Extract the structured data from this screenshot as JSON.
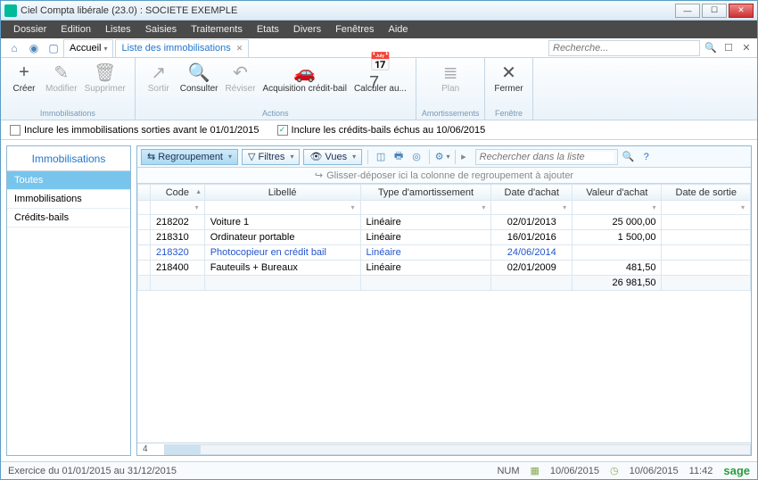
{
  "window": {
    "title": "Ciel Compta libérale (23.0) : SOCIETE EXEMPLE"
  },
  "menu": [
    "Dossier",
    "Edition",
    "Listes",
    "Saisies",
    "Traitements",
    "Etats",
    "Divers",
    "Fenêtres",
    "Aide"
  ],
  "tabs": {
    "home": "Accueil",
    "active": "Liste des immobilisations"
  },
  "nav_search": {
    "placeholder": "Recherche..."
  },
  "ribbon": {
    "groups": [
      {
        "label": "Immobilisations",
        "buttons": [
          {
            "icon": "+",
            "label": "Créer",
            "enabled": true
          },
          {
            "icon": "✎",
            "label": "Modifier",
            "enabled": false
          },
          {
            "icon": "🗑",
            "label": "Supprimer",
            "enabled": false
          }
        ]
      },
      {
        "label": "Actions",
        "buttons": [
          {
            "icon": "↗",
            "label": "Sortir",
            "enabled": false
          },
          {
            "icon": "🔍",
            "label": "Consulter",
            "enabled": true
          },
          {
            "icon": "↶",
            "label": "Réviser",
            "enabled": false
          },
          {
            "icon": "🚗",
            "label": "Acquisition\ncrédit-bail",
            "enabled": true
          },
          {
            "icon": "📅7",
            "label": "Calculer au...",
            "enabled": true
          }
        ]
      },
      {
        "label": "Amortissements",
        "buttons": [
          {
            "icon": "≣",
            "label": "Plan",
            "enabled": false
          }
        ]
      },
      {
        "label": "Fenêtre",
        "buttons": [
          {
            "icon": "✕",
            "label": "Fermer",
            "enabled": true
          }
        ]
      }
    ]
  },
  "filters": {
    "opt1": "Inclure les immobilisations sorties avant le 01/01/2015",
    "opt1_checked": false,
    "opt2": "Inclure les crédits-bails échus au 10/06/2015",
    "opt2_checked": true
  },
  "sidebar": {
    "title": "Immobilisations",
    "items": [
      "Toutes",
      "Immobilisations",
      "Crédits-bails"
    ],
    "selected": 0
  },
  "gridbar": {
    "regroupement": "Regroupement",
    "filtres": "Filtres",
    "vues": "Vues",
    "search_placeholder": "Rechercher dans la liste"
  },
  "grid": {
    "group_hint": "Glisser-déposer ici la colonne de regroupement à ajouter",
    "columns": [
      "Code",
      "Libellé",
      "Type d'amortissement",
      "Date d'achat",
      "Valeur d'achat",
      "Date de sortie"
    ],
    "rows": [
      {
        "code": "218202",
        "libelle": "Voiture 1",
        "type": "Linéaire",
        "date_achat": "02/01/2013",
        "valeur": "25 000,00",
        "sortie": "",
        "link": false
      },
      {
        "code": "218310",
        "libelle": "Ordinateur portable",
        "type": "Linéaire",
        "date_achat": "16/01/2016",
        "valeur": "1 500,00",
        "sortie": "",
        "link": false
      },
      {
        "code": "218320",
        "libelle": "Photocopieur en crédit bail",
        "type": "Linéaire",
        "date_achat": "24/06/2014",
        "valeur": "",
        "sortie": "",
        "link": true
      },
      {
        "code": "218400",
        "libelle": "Fauteuils + Bureaux",
        "type": "Linéaire",
        "date_achat": "02/01/2009",
        "valeur": "481,50",
        "sortie": "",
        "link": false
      }
    ],
    "sum_valeur": "26 981,50",
    "row_count": "4"
  },
  "status": {
    "exercice": "Exercice du 01/01/2015 au 31/12/2015",
    "num": "NUM",
    "date1": "10/06/2015",
    "date2": "10/06/2015",
    "time": "11:42",
    "brand": "sage"
  }
}
